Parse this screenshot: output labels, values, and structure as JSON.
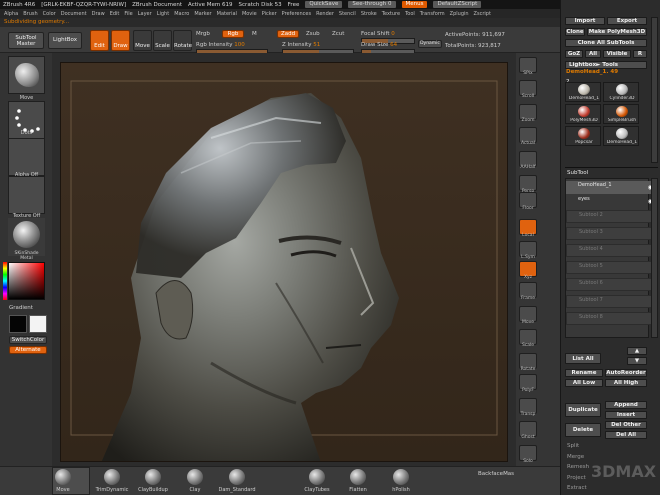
{
  "titlebar": {
    "app": "ZBrush 4R6",
    "serial": "[GRLK-EKBF-QZQR-TYWI-NRIW]",
    "document": "ZBrush Document",
    "active_mem": "Active Mem 619",
    "scratch": "Scratch Disk 53",
    "free": "Free",
    "quicksave": "QuickSave",
    "seethrough": "See-through",
    "seethrough_value": "0",
    "menus": "Menus",
    "zscript": "DefaultZScript"
  },
  "menubar": [
    "Alpha",
    "Brush",
    "Color",
    "Document",
    "Draw",
    "Edit",
    "File",
    "Layer",
    "Light",
    "Macro",
    "Marker",
    "Material",
    "Movie",
    "Picker",
    "Preferences",
    "Render",
    "Stencil",
    "Stroke",
    "Texture",
    "Tool",
    "Transform",
    "Zplugin",
    "Zscript"
  ],
  "status": "Subdividing geometry...",
  "top": {
    "subtool_master": "SubTool Master",
    "lightbox": "LightBox",
    "edit": "Edit",
    "draw": "Draw",
    "move": "Move",
    "scale": "Scale",
    "rotate": "Rotate",
    "mrgb": "Mrgb",
    "rgb": "Rgb",
    "m": "M",
    "zadd": "Zadd",
    "zsub": "Zsub",
    "zcut": "Zcut",
    "rgb_intensity_label": "Rgb Intensity",
    "rgb_intensity_value": "100",
    "z_intensity_label": "Z Intensity",
    "z_intensity_value": "51",
    "focal_shift_label": "Focal Shift",
    "focal_shift_value": "0",
    "draw_size_label": "Draw Size",
    "draw_size_value": "64",
    "dynamic": "Dynamic",
    "active_points": "ActivePoints: 911,697",
    "total_points": "TotalPoints: 923,817"
  },
  "left": {
    "move": "Move",
    "dots": "Dots",
    "alpha_off": "Alpha Off",
    "texture_off": "Texture Off",
    "material": "SKinShade Metal",
    "gradient": "Gradient",
    "switchcolor": "SwitchColor",
    "alternate": "Alternate"
  },
  "right_shelf": [
    "SPix",
    "Scroll",
    "Zoom",
    "Actual",
    "AAHalf",
    "Persp",
    "Floor",
    "Local",
    "L.Sym",
    "Xyz",
    "Frame",
    "Move",
    "Scale",
    "Rotate",
    "PolyF",
    "Transp",
    "Ghost",
    "Solo"
  ],
  "right_shelf_xyz_active": "Xyz",
  "tray": {
    "import": "Import",
    "export": "Export",
    "clone": "Clone",
    "make_polymesh": "Make PolyMesh3D",
    "clone_all": "Clone All SubTools",
    "goz": "GoZ",
    "all": "All",
    "visible": "Visible",
    "r": "R",
    "lightbox_tools": "Lightbox► Tools",
    "current_tool": "DemoHead_1. 49",
    "tool_count": "2",
    "tools": [
      {
        "name": "DemoHead_1",
        "icon": "head-icon"
      },
      {
        "name": "Cylinder3D",
        "icon": "cylinder-icon"
      },
      {
        "name": "PolyMesh3D",
        "icon": "star-icon"
      },
      {
        "name": "SimpleBrush",
        "icon": "simplebrush-icon"
      },
      {
        "name": "Popcsar",
        "icon": "popcsar-icon"
      },
      {
        "name": "DemoHead_1",
        "icon": "head-icon"
      }
    ],
    "subtool_header": "SubTool",
    "subtools": [
      "DemoHead_1",
      "eyes"
    ],
    "empty_slots": [
      "Subtool 2",
      "Subtool 3",
      "Subtool 4",
      "Subtool 5",
      "Subtool 6",
      "Subtool 7",
      "Subtool 8"
    ],
    "list_all": "List All",
    "rename": "Rename",
    "autoreorder": "AutoReorder",
    "all_low": "All Low",
    "all_high": "All High",
    "duplicate": "Duplicate",
    "append": "Append",
    "insert": "Insert",
    "delete": "Delete",
    "del_other": "Del Other",
    "del_all": "Del All",
    "split": "Split",
    "merge": "Merge",
    "remesh": "Remesh",
    "project": "Project",
    "extract": "Extract"
  },
  "bottom": {
    "brushes": [
      "Move",
      "TrimDynamic",
      "ClayBuildup",
      "Clay",
      "Dam_Standard",
      "ClayTubes",
      "Flatten",
      "hPolish"
    ],
    "backfacemask": "BackfaceMas"
  },
  "watermark": "3DMAX"
}
